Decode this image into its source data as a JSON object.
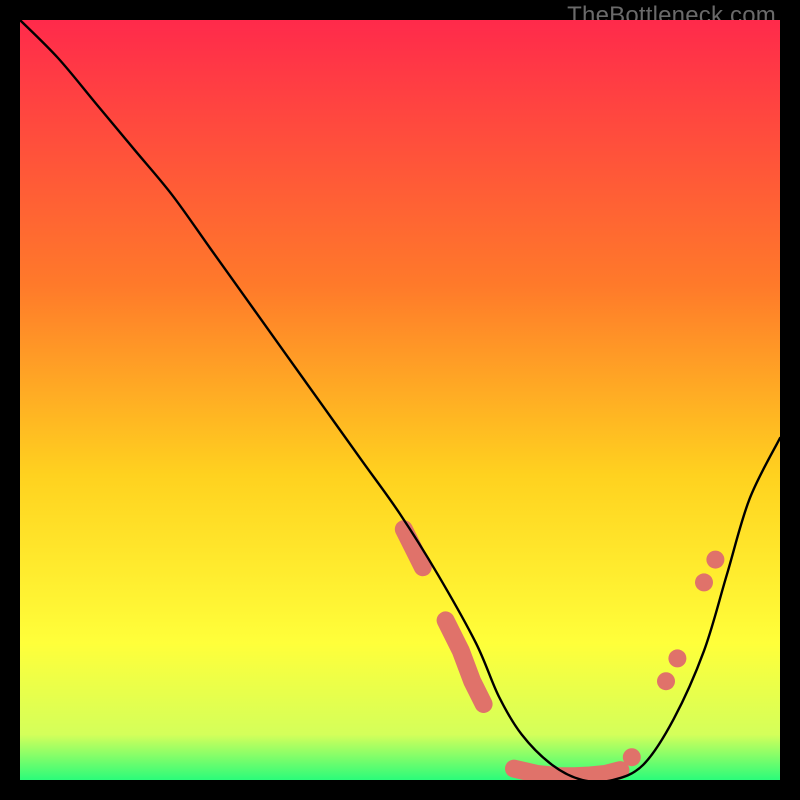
{
  "watermark": "TheBottleneck.com",
  "chart_data": {
    "type": "line",
    "title": "",
    "xlabel": "",
    "ylabel": "",
    "xlim": [
      0,
      100
    ],
    "ylim": [
      0,
      100
    ],
    "grid": false,
    "legend": false,
    "gradient_stops": [
      {
        "offset": 0,
        "color": "#ff2a4b"
      },
      {
        "offset": 35,
        "color": "#ff7a2a"
      },
      {
        "offset": 60,
        "color": "#ffd21f"
      },
      {
        "offset": 82,
        "color": "#ffff3a"
      },
      {
        "offset": 94,
        "color": "#d4ff5a"
      },
      {
        "offset": 100,
        "color": "#2bfc7a"
      }
    ],
    "series": [
      {
        "name": "bottleneck-curve",
        "color": "#000000",
        "x": [
          0,
          5,
          10,
          15,
          20,
          25,
          30,
          35,
          40,
          45,
          50,
          55,
          60,
          63,
          66,
          70,
          74,
          78,
          82,
          86,
          90,
          93,
          96,
          100
        ],
        "y": [
          100,
          95,
          89,
          83,
          77,
          70,
          63,
          56,
          49,
          42,
          35,
          27,
          18,
          11,
          6,
          2,
          0,
          0,
          2,
          8,
          17,
          27,
          37,
          45
        ]
      }
    ],
    "marker_clusters": [
      {
        "name": "cluster-left-upper",
        "shape": "capsule",
        "color": "#e0726a",
        "points": [
          {
            "x": 50.5,
            "y": 33
          },
          {
            "x": 52.0,
            "y": 30
          },
          {
            "x": 53.0,
            "y": 28
          }
        ]
      },
      {
        "name": "cluster-left-lower",
        "shape": "capsule",
        "color": "#e0726a",
        "points": [
          {
            "x": 56.0,
            "y": 21
          },
          {
            "x": 58.0,
            "y": 17
          },
          {
            "x": 59.5,
            "y": 13
          },
          {
            "x": 61.0,
            "y": 10
          }
        ]
      },
      {
        "name": "cluster-valley",
        "shape": "capsule",
        "color": "#e0726a",
        "points": [
          {
            "x": 65.0,
            "y": 1.5
          },
          {
            "x": 68.0,
            "y": 0.8
          },
          {
            "x": 71.0,
            "y": 0.5
          },
          {
            "x": 73.0,
            "y": 0.5
          },
          {
            "x": 75.0,
            "y": 0.6
          },
          {
            "x": 77.0,
            "y": 0.8
          },
          {
            "x": 79.0,
            "y": 1.3
          }
        ]
      },
      {
        "name": "cluster-right-dots",
        "shape": "dot",
        "color": "#e0726a",
        "points": [
          {
            "x": 80.5,
            "y": 3
          },
          {
            "x": 85.0,
            "y": 13
          },
          {
            "x": 86.5,
            "y": 16
          },
          {
            "x": 90.0,
            "y": 26
          },
          {
            "x": 91.5,
            "y": 29
          }
        ]
      }
    ]
  }
}
